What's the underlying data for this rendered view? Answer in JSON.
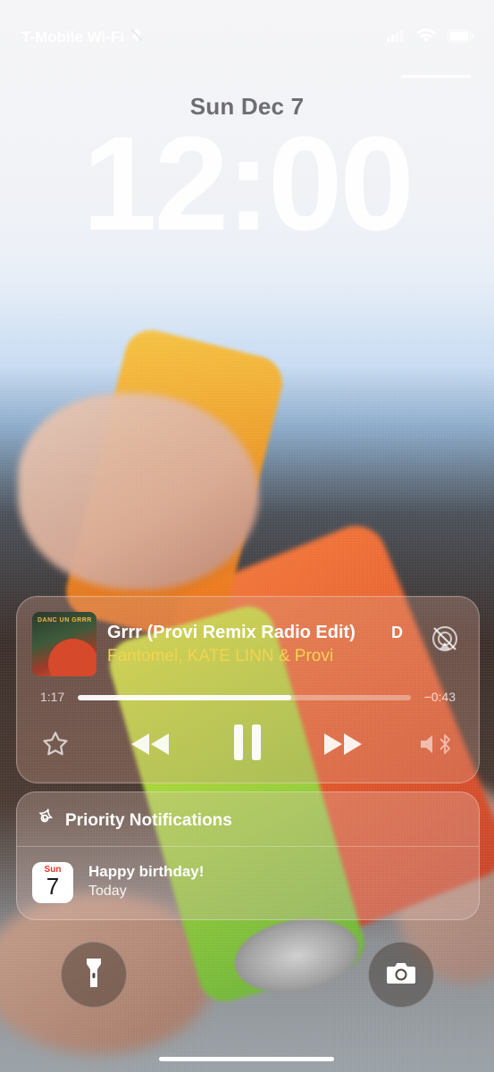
{
  "status_bar": {
    "carrier": "T-Mobile Wi-Fi",
    "icons": [
      "bell-slash-icon",
      "signal-icon",
      "wifi-icon",
      "battery-icon"
    ]
  },
  "lock_screen": {
    "date": "Sun Dec 7",
    "time": "12:00"
  },
  "now_playing": {
    "title": "Grrr (Provi Remix Radio Edit)",
    "artist": "Fantomel, KATE LINN & Provi",
    "album_art_text": "DANC UN GRRR",
    "device_label": "D",
    "elapsed": "1:17",
    "remaining": "−0:43",
    "progress_fraction": 0.64,
    "controls": [
      "star-icon",
      "rewind-icon",
      "pause-icon",
      "fast-forward-icon",
      "volume-bluetooth-icon"
    ],
    "accent_color": "#f2d44f"
  },
  "notifications": {
    "group_title": "Priority Notifications",
    "items": [
      {
        "app": "Calendar",
        "icon_day": "Sun",
        "icon_date": "7",
        "message": "Happy birthday!",
        "subtitle": "Today"
      }
    ]
  },
  "quick_actions": {
    "left": "flashlight-icon",
    "right": "camera-icon"
  }
}
